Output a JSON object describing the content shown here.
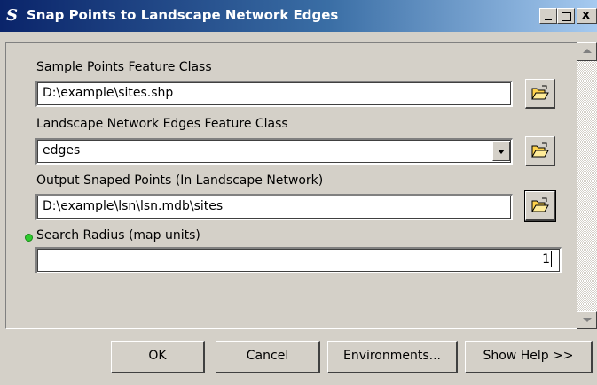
{
  "window": {
    "title": "Snap Points to Landscape Network Edges",
    "icon": "toolbox-s-icon",
    "controls": {
      "minimize": "",
      "maximize": "",
      "close": "x"
    }
  },
  "fields": {
    "sample_points": {
      "label": "Sample Points Feature Class",
      "value": "D:\\example\\sites.shp"
    },
    "network_edges": {
      "label": "Landscape Network Edges Feature Class",
      "value": "edges"
    },
    "output_points": {
      "label": "Output Snaped Points  (In Landscape Network)",
      "value": "D:\\example\\lsn\\lsn.mdb\\sites"
    },
    "search_radius": {
      "label": "Search Radius (map units)",
      "value": "1",
      "required_indicator_color": "#2ecc2e"
    }
  },
  "buttons": {
    "ok": "OK",
    "cancel": "Cancel",
    "environments": "Environments...",
    "show_help": "Show Help >>"
  },
  "colors": {
    "dialog_bg": "#d4d0c8",
    "titlebar_start": "#0a246a",
    "titlebar_end": "#a6caf0"
  }
}
